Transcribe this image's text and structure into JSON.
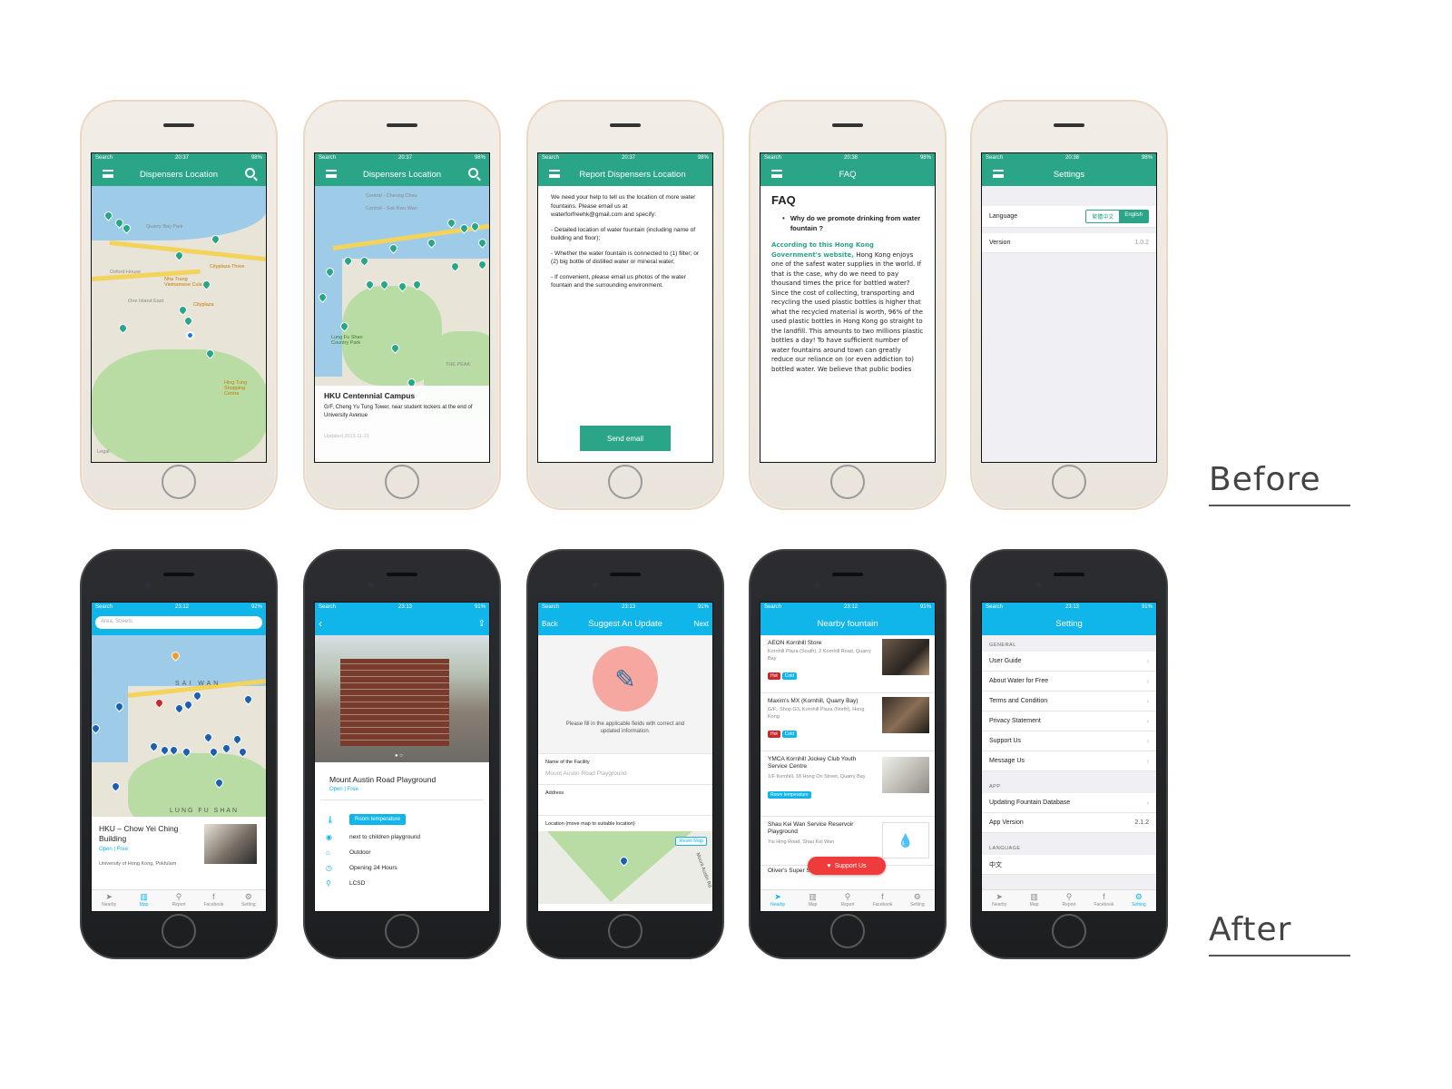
{
  "labels": {
    "before": "Before",
    "after": "After"
  },
  "status": {
    "b1": {
      "carrier": "Search",
      "time": "20:37",
      "battery": "98%"
    },
    "b2": {
      "carrier": "Search",
      "time": "20:37",
      "battery": "98%"
    },
    "b3": {
      "carrier": "Search",
      "time": "20:37",
      "battery": "98%"
    },
    "b4": {
      "carrier": "Search",
      "time": "20:38",
      "battery": "98%"
    },
    "b5": {
      "carrier": "Search",
      "time": "20:38",
      "battery": "98%"
    },
    "a1": {
      "carrier": "Search",
      "time": "23:12",
      "battery": "92%"
    },
    "a2": {
      "carrier": "Search",
      "time": "23:13",
      "battery": "91%"
    },
    "a3": {
      "carrier": "Search",
      "time": "23:13",
      "battery": "91%"
    },
    "a4": {
      "carrier": "Search",
      "time": "23:12",
      "battery": "91%"
    },
    "a5": {
      "carrier": "Search",
      "time": "23:13",
      "battery": "91%"
    }
  },
  "before": {
    "map": {
      "title": "Dispensers Location",
      "places": [
        "Quarry Bay Park",
        "Cityplaza Three",
        "Nha Trang Vietnamese Cuisine",
        "Cityplaza",
        "Oxford House",
        "One Island East",
        "Hing Tung Shopping Centre",
        "Legal"
      ]
    },
    "detail": {
      "title": "Dispensers Location",
      "places": [
        "Central - Cheung Chau",
        "Central - Sok Kwu Wan",
        "THE PEAK",
        "Lung Fu Shan Country Park"
      ],
      "card_title": "HKU Centennial Campus",
      "card_desc": "G/F, Cheng Yu Tung Tower, near student lockers at the end of University Avenue",
      "card_updated": "Updated 2013-11-21"
    },
    "report": {
      "title": "Report Dispensers Location",
      "body": [
        "We need your help to tell us the location of more water fountains.  Please email us at waterforfreehk@gmail.com and specify:",
        "- Detailed location of water fountain (including name of building and floor);",
        "- Whether the water fountain is connected to (1) filter; or (2) big bottle of distilled water or mineral water;",
        "- If convenient, please email us photos of the water fountain and the surrounding environment."
      ],
      "button": "Send email"
    },
    "faq": {
      "title": "FAQ",
      "heading": "FAQ",
      "question": "Why do we promote drinking from water fountain ?",
      "link": "According to this Hong Kong Government's website,",
      "answer": "Hong Kong enjoys one of the safest water supplies in the world. If that is the case, why do we need to pay thousand times the price for bottled water? Since the cost of collecting, transporting and recycling the used plastic bottles is higher that what the recycled material is worth, 96% of the used plastic bottles in Hong Kong go straight to the landfill. This amounts to two millions plastic bottles a day! To have sufficient number of water fountains around town can greatly reduce our reliance on (or even addiction to) bottled water. We believe that public bodies"
    },
    "settings": {
      "title": "Settings",
      "language_label": "Language",
      "lang_zh": "繁體中文",
      "lang_en": "English",
      "version_label": "Version",
      "version_value": "1.0.2"
    }
  },
  "after": {
    "map": {
      "search_placeholder": "Area, Streets",
      "places": [
        "SAI WAN",
        "LUNG FU SHAN"
      ],
      "card_title": "HKU – Chow Yei Ching Building",
      "card_status": "Open | Free",
      "card_addr": "University of Hong Kong, Pokfulam"
    },
    "detail": {
      "title": "Mount Austin Road Playground",
      "status": "Open | Free",
      "tag": "Room temperature",
      "facts": [
        "next to children playground",
        "Outdoor",
        "Opening 24 Hours",
        "LCSD"
      ]
    },
    "suggest": {
      "back": "Back",
      "title": "Suggest An Update",
      "next": "Next",
      "note": "Please fill in the applicable fields with correct and updated information.",
      "name_label": "Name of the Facility",
      "name_value": "Mount Austin Road Playground",
      "address_label": "Address",
      "location_label": "Location (move map to suitable location)",
      "reset": "Reset Map",
      "road": "Mount Austin Rd"
    },
    "nearby": {
      "title": "Nearby fountain",
      "items": [
        {
          "name": "AEON Kornhill Store",
          "addr": "Kornhill Plaza (South), 2 Kornhill Road, Quarry Bay",
          "tags": [
            "Hot",
            "Cold"
          ]
        },
        {
          "name": "Maxim's MX (Kornhill, Quarry Bay)",
          "addr": "G/F., Shop G3, Kornhill Plaza (North), Hong Kong",
          "tags": [
            "Hot",
            "Cold"
          ]
        },
        {
          "name": "YMCA Kornhill Jockey Club Youth Service Centre",
          "addr": "1/F Kornhill, 18 Hong On Street, Quarry Bay",
          "tags": [
            "Room temperature"
          ]
        },
        {
          "name": "Shau Kei Wan Service Reservoir Playground",
          "addr": "Yiu Hing Road, Shau Kei Wan",
          "tags": []
        },
        {
          "name": "Oliver's Super Sandwiches (Tai",
          "addr": "",
          "tags": []
        }
      ],
      "support_button": "Support Us"
    },
    "setting": {
      "title": "Setting",
      "general_h": "GENERAL",
      "general": [
        "User Guide",
        "About Water for Free",
        "Terms and Condition",
        "Privacy Statement",
        "Support Us",
        "Message Us"
      ],
      "app_h": "APP",
      "app_update": "Updating Fountain Database",
      "app_version_label": "App Version",
      "app_version": "2.1.2",
      "language_h": "LANGUAGE",
      "language_first": "中文"
    },
    "tabs": [
      "Nearby",
      "Map",
      "Report",
      "Facebook",
      "Setting"
    ]
  },
  "colors": {
    "teal": "#2ba588",
    "cyan": "#10b5ea",
    "hot": "#c8292b",
    "cold": "#10b5ea",
    "support": "#ef3b3b"
  },
  "icons": {
    "menu": "hamburger-icon",
    "search": "search-icon",
    "pin": "map-pin-icon",
    "back": "chevron-left-icon",
    "share": "share-icon"
  }
}
